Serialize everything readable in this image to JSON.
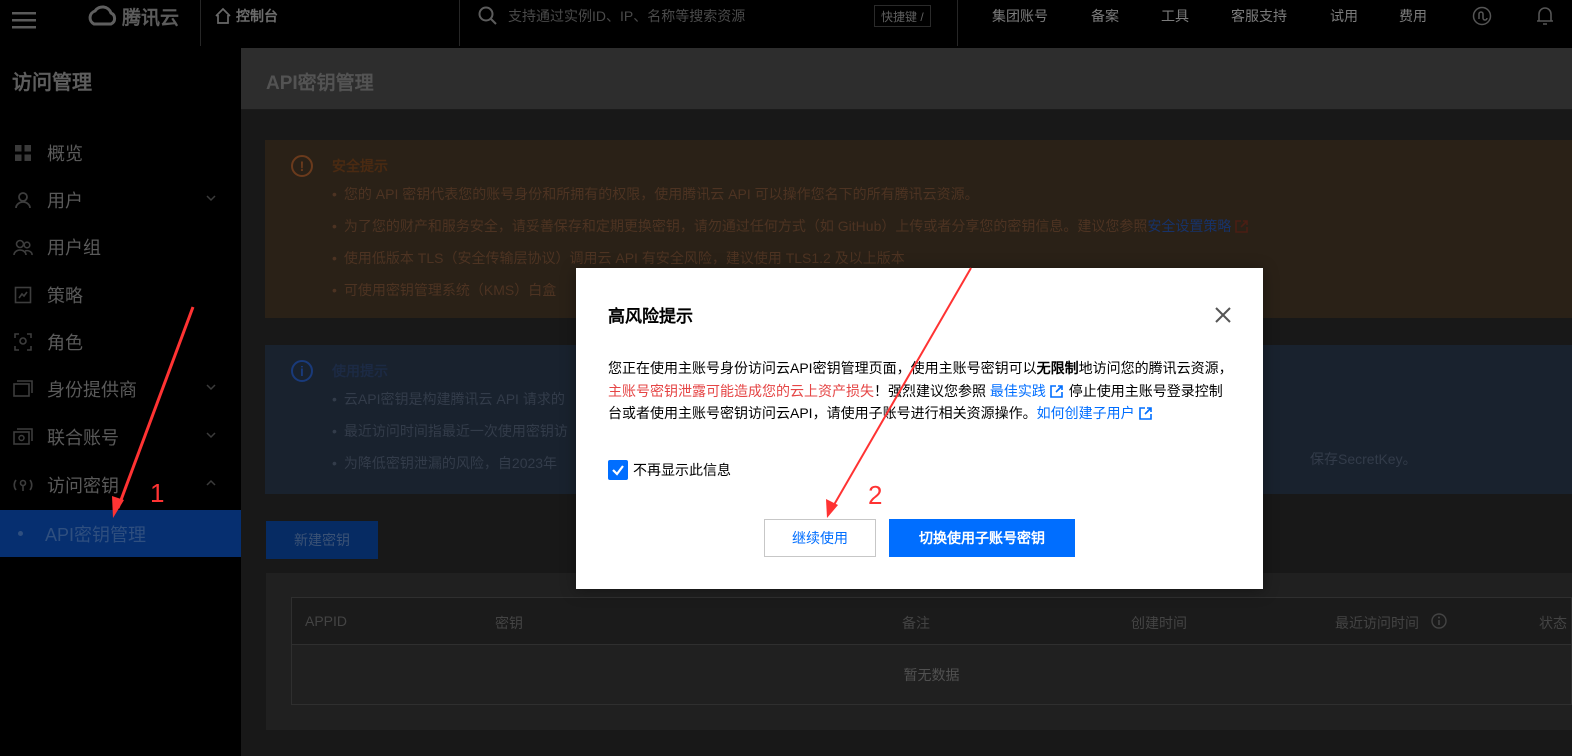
{
  "topbar": {
    "brand": "腾讯云",
    "console": "控制台",
    "search_placeholder": "支持通过实例ID、IP、名称等搜索资源",
    "shortcut": "快捷键 /",
    "nav": [
      "集团账号",
      "备案",
      "工具",
      "客服支持",
      "试用",
      "费用"
    ]
  },
  "sidebar": {
    "title": "访问管理",
    "items": [
      {
        "label": "概览",
        "icon": "grid-icon"
      },
      {
        "label": "用户",
        "icon": "user-icon",
        "has_chevron": true
      },
      {
        "label": "用户组",
        "icon": "user-group-icon"
      },
      {
        "label": "策略",
        "icon": "policy-icon"
      },
      {
        "label": "角色",
        "icon": "role-icon"
      },
      {
        "label": "身份提供商",
        "icon": "identity-provider-icon",
        "has_chevron": true
      },
      {
        "label": "联合账号",
        "icon": "federated-account-icon",
        "has_chevron": true
      },
      {
        "label": "访问密钥",
        "icon": "key-icon",
        "expanded": true
      },
      {
        "label": "API密钥管理",
        "active": true
      }
    ]
  },
  "page": {
    "title": "API密钥管理",
    "security_notice": {
      "title": "安全提示",
      "items": [
        "您的 API 密钥代表您的账号身份和所拥有的权限，使用腾讯云 API 可以操作您名下的所有腾讯云资源。",
        "为了您的财产和服务安全，请妥善保存和定期更换密钥，请勿通过任何方式（如 GitHub）上传或者分享您的密钥信息。建议您参照",
        "使用低版本 TLS（安全传输层协议）调用云 API 有安全风险，建议使用 TLS1.2 及以上版本",
        "可使用密钥管理系统（KMS）白盒"
      ],
      "link": "安全设置策略"
    },
    "usage_notice": {
      "title": "使用提示",
      "items": [
        "云API密钥是构建腾讯云 API 请求的",
        "最近访问时间指最近一次使用密钥访",
        "为降低密钥泄漏的风险，自2023年"
      ],
      "tail_text": "保存SecretKey。"
    },
    "new_key_button": "新建密钥",
    "table": {
      "columns": [
        "APPID",
        "密钥",
        "备注",
        "创建时间",
        "最近访问时间",
        "状态"
      ],
      "empty_text": "暂无数据"
    }
  },
  "modal": {
    "title": "高风险提示",
    "body": {
      "p1": "您正在使用主账号身份访问云API密钥管理页面，使用主账号密钥可以",
      "bold": "无限制",
      "p2": "地访问您的腾讯云资源，",
      "red": "主账号密钥泄露可能造成您的云上资产损失",
      "p3": "！强烈建议您参照 ",
      "link1": "最佳实践",
      "p4": " 停止使用主账号登录控制台或者使用主账号密钥访问云API，请使用子账号进行相关资源操作。",
      "link2": "如何创建子用户"
    },
    "checkbox_label": "不再显示此信息",
    "checkbox_checked": true,
    "continue_button": "继续使用",
    "switch_button": "切换使用子账号密钥"
  },
  "annotations": {
    "marker1": "1",
    "marker2": "2",
    "color": "#ff3333"
  },
  "colors": {
    "primary": "#006eff",
    "danger": "#e54545"
  }
}
